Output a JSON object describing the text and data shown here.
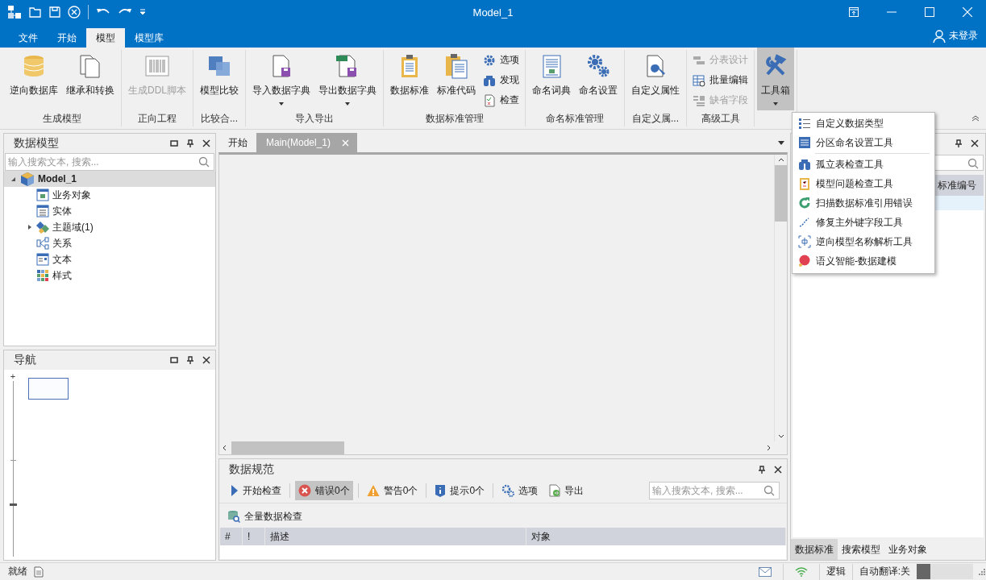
{
  "window": {
    "title": "Model_1"
  },
  "menu_tabs": [
    {
      "label": "文件",
      "selected": false
    },
    {
      "label": "开始",
      "selected": false
    },
    {
      "label": "模型",
      "selected": true
    },
    {
      "label": "模型库",
      "selected": false
    }
  ],
  "user": {
    "label": "未登录"
  },
  "ribbon": {
    "groups": [
      {
        "label": "生成模型",
        "items": [
          {
            "kind": "large",
            "label": "逆向数据库",
            "disabled": false,
            "dropdown": false,
            "pressed": false
          },
          {
            "kind": "large",
            "label": "继承和转换",
            "disabled": false,
            "dropdown": false,
            "pressed": false
          }
        ]
      },
      {
        "label": "正向工程",
        "items": [
          {
            "kind": "large",
            "label": "生成DDL脚本",
            "disabled": true,
            "dropdown": false,
            "pressed": false
          }
        ]
      },
      {
        "label": "比较合...",
        "items": [
          {
            "kind": "large",
            "label": "模型比较",
            "disabled": false,
            "dropdown": false,
            "pressed": false
          }
        ]
      },
      {
        "label": "导入导出",
        "items": [
          {
            "kind": "large",
            "label": "导入数据字典",
            "disabled": false,
            "dropdown": true,
            "pressed": false
          },
          {
            "kind": "large",
            "label": "导出数据字典",
            "disabled": false,
            "dropdown": true,
            "pressed": false
          }
        ]
      },
      {
        "label": "数据标准管理",
        "items": [
          {
            "kind": "large",
            "label": "数据标准",
            "disabled": false,
            "dropdown": false,
            "pressed": false
          },
          {
            "kind": "large",
            "label": "标准代码",
            "disabled": false,
            "dropdown": false,
            "pressed": false
          },
          {
            "kind": "stack",
            "buttons": [
              {
                "label": "选项",
                "disabled": false
              },
              {
                "label": "发现",
                "disabled": false
              },
              {
                "label": "检查",
                "disabled": false
              }
            ]
          }
        ]
      },
      {
        "label": "命名标准管理",
        "items": [
          {
            "kind": "large",
            "label": "命名词典",
            "disabled": false,
            "dropdown": false,
            "pressed": false
          },
          {
            "kind": "large",
            "label": "命名设置",
            "disabled": false,
            "dropdown": false,
            "pressed": false
          }
        ]
      },
      {
        "label": "自定义属...",
        "items": [
          {
            "kind": "large",
            "label": "自定义属性",
            "disabled": false,
            "dropdown": false,
            "pressed": false
          }
        ]
      },
      {
        "label": "高级工具",
        "items": [
          {
            "kind": "stack",
            "buttons": [
              {
                "label": "分表设计",
                "disabled": true
              },
              {
                "label": "批量编辑",
                "disabled": false
              },
              {
                "label": "缺省字段",
                "disabled": true
              }
            ]
          }
        ]
      },
      {
        "items": [
          {
            "kind": "large",
            "label": "工具箱",
            "disabled": false,
            "dropdown": true,
            "pressed": true
          }
        ]
      }
    ]
  },
  "toolbox_menu": {
    "sections": [
      [
        {
          "label": "自定义数据类型"
        },
        {
          "label": "分区命名设置工具"
        }
      ],
      [
        {
          "label": "孤立表检查工具"
        },
        {
          "label": "模型问题检查工具"
        },
        {
          "label": "扫描数据标准引用错误"
        },
        {
          "label": "修复主外键字段工具"
        },
        {
          "label": "逆向模型名称解析工具"
        },
        {
          "label": "语义智能-数据建模"
        }
      ]
    ]
  },
  "model_panel": {
    "title": "数据模型",
    "search": {
      "placeholder": "输入搜索文本, 搜索..."
    },
    "tree": [
      {
        "label": "Model_1",
        "expanded": true,
        "selected": true,
        "children": [
          {
            "label": "业务对象",
            "selected": false
          },
          {
            "label": "实体",
            "selected": false
          },
          {
            "label": "主题域(1)",
            "expanded": false,
            "selected": false
          },
          {
            "label": "关系",
            "selected": false
          },
          {
            "label": "文本",
            "selected": false
          },
          {
            "label": "样式",
            "selected": false
          }
        ]
      }
    ]
  },
  "nav_panel": {
    "title": "导航",
    "zoom": {
      "label": "+",
      "level": 0.29
    }
  },
  "doc_tabs": [
    {
      "label": "开始",
      "selected": false,
      "closable": false
    },
    {
      "label": "Main(Model_1)",
      "selected": true,
      "closable": true
    }
  ],
  "spec_panel": {
    "title": "数据规范",
    "toolbar": [
      {
        "label": "开始检查",
        "pressed": false
      },
      {
        "label": "错误0个",
        "pressed": true
      },
      {
        "label": "警告0个",
        "pressed": false
      },
      {
        "label": "提示0个",
        "pressed": false
      },
      {
        "label": "选项",
        "pressed": false
      },
      {
        "label": "导出",
        "pressed": false
      }
    ],
    "search": {
      "placeholder": "输入搜索文本, 搜索..."
    },
    "full_check": "全量数据检查",
    "columns": [
      "#",
      "!",
      "描述",
      "对象"
    ]
  },
  "right_panel": {
    "columns": [
      "标准编号"
    ],
    "rows": [
      {
        "selected": true
      }
    ],
    "tabs": [
      {
        "label": "数据标准",
        "selected": true
      },
      {
        "label": "搜索模型",
        "selected": false
      },
      {
        "label": "业务对象",
        "selected": false
      }
    ]
  },
  "status_bar": {
    "text": "就绪",
    "mode": "逻辑",
    "translate": "自动翻译:关",
    "progress": {
      "level": 0.24
    }
  }
}
